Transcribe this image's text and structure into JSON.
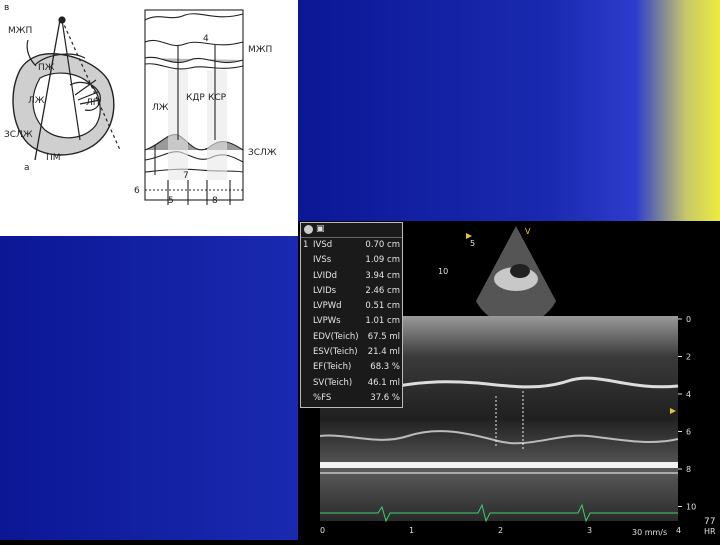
{
  "diagram": {
    "panel_a_letter": "в",
    "left_labels": {
      "mzhp": "МЖП",
      "pzh": "ПЖ",
      "lzh": "ЛЖ",
      "lp": "ЛП",
      "zslzh": "ЗСЛЖ",
      "pm": "ПМ",
      "a": "а"
    },
    "right_labels": {
      "num4": "4",
      "mzhp": "МЖП",
      "kdr": "КДР",
      "ksr": "КСР",
      "lzh": "ЛЖ",
      "num7": "7",
      "zslzh": "ЗСЛЖ",
      "num6": "6",
      "num5": "5",
      "num8": "8"
    }
  },
  "echo": {
    "header_icon": "camera-icon",
    "panel_index": "1",
    "measurements": [
      {
        "label": "IVSd",
        "value": "0.70 cm"
      },
      {
        "label": "IVSs",
        "value": "1.09 cm"
      },
      {
        "label": "LVIDd",
        "value": "3.94 cm"
      },
      {
        "label": "LVIDs",
        "value": "2.46 cm"
      },
      {
        "label": "LVPWd",
        "value": "0.51 cm"
      },
      {
        "label": "LVPWs",
        "value": "1.01 cm"
      },
      {
        "label": "EDV(Teich)",
        "value": "67.5 ml"
      },
      {
        "label": "ESV(Teich)",
        "value": "21.4 ml"
      },
      {
        "label": "EF(Teich)",
        "value": "68.3 %"
      },
      {
        "label": "SV(Teich)",
        "value": "46.1 ml"
      },
      {
        "label": "%FS",
        "value": "37.6 %"
      }
    ],
    "sector_labels": {
      "v": "V",
      "five": "5",
      "ten": "10"
    },
    "depth_scale": [
      "0",
      "2",
      "4",
      "6",
      "8",
      "10"
    ],
    "time_scale": [
      "0",
      "1",
      "2",
      "3",
      "4"
    ],
    "sweep_speed": "30 mm/s",
    "heart_rate": "77",
    "hr_label": "HR"
  }
}
